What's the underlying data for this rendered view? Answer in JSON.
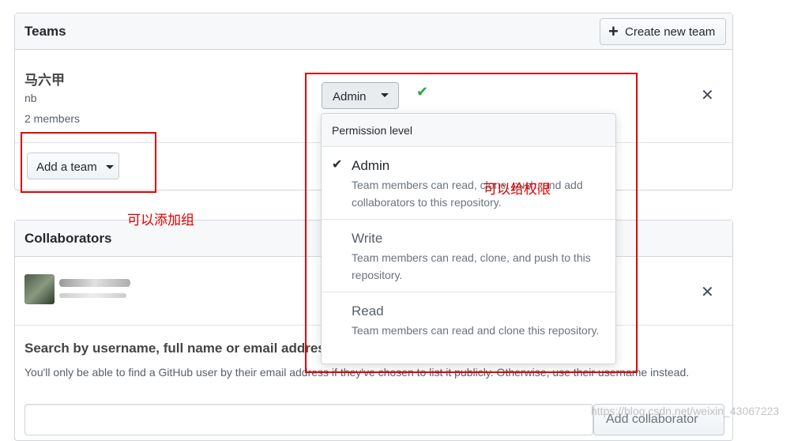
{
  "teams": {
    "title": "Teams",
    "create_button": "Create new team",
    "team": {
      "name": "马六甲",
      "slug": "nb",
      "members": "2 members",
      "role": "Admin"
    },
    "add_team_button": "Add a team"
  },
  "permission_menu": {
    "header": "Permission level",
    "items": [
      {
        "title": "Admin",
        "desc": "Team members can read, clone, push, and add collaborators to this repository.",
        "selected": true
      },
      {
        "title": "Write",
        "desc": "Team members can read, clone, and push to this repository.",
        "selected": false
      },
      {
        "title": "Read",
        "desc": "Team members can read and clone this repository.",
        "selected": false
      }
    ]
  },
  "annotations": {
    "permission_note": "可以给权限",
    "team_note": "可以添加组"
  },
  "collaborators": {
    "title": "Collaborators",
    "search_heading": "Search by username, full name or email address",
    "search_help": "You'll only be able to find a GitHub user by their email address if they've chosen to list it publicly. Otherwise, use their username instead.",
    "add_button": "Add collaborator",
    "search_value": ""
  },
  "watermark": "https://blog.csdn.net/weixin_43067223",
  "colors": {
    "annotation_red": "#e00000",
    "check_green": "#28a745",
    "border": "#d1d5da"
  }
}
